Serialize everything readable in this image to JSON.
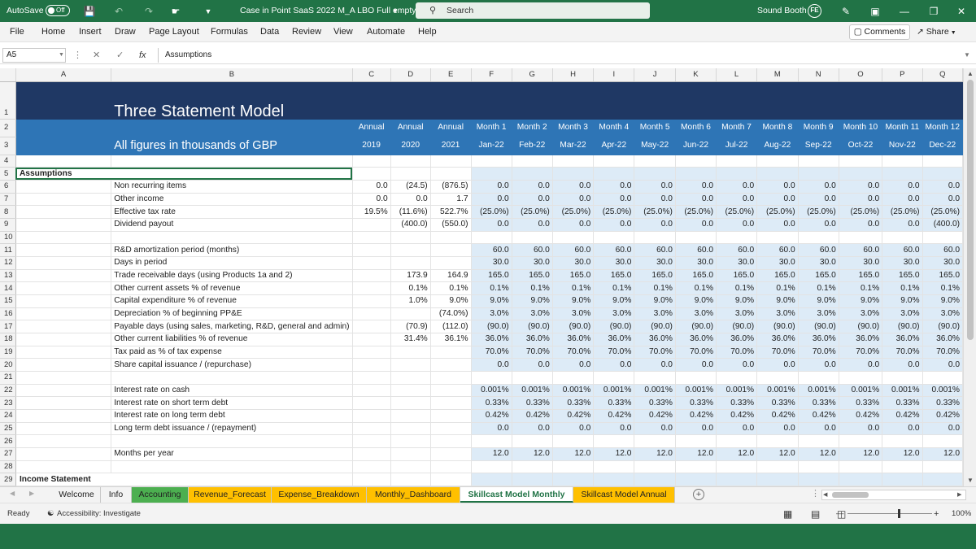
{
  "titlebar": {
    "autosave_label": "AutoSave",
    "autosave_state": "Off",
    "file_title": "Case in Point SaaS 2022 M_A LBO Full empty",
    "search_placeholder": "Search",
    "user_name": "Sound Booth",
    "user_initials": "FE"
  },
  "menu": [
    "File",
    "Home",
    "Insert",
    "Draw",
    "Page Layout",
    "Formulas",
    "Data",
    "Review",
    "View",
    "Automate",
    "Help"
  ],
  "comments_label": "Comments",
  "share_label": "Share",
  "formula_bar": {
    "name_box": "A5",
    "fx": "fx",
    "formula": "Assumptions"
  },
  "columns": [
    "A",
    "B",
    "C",
    "D",
    "E",
    "F",
    "G",
    "H",
    "I",
    "J",
    "K",
    "L",
    "M",
    "N",
    "O",
    "P",
    "Q"
  ],
  "sheet": {
    "title": "Three Statement Model",
    "subtitle": "All figures in thousands of GBP",
    "period_types": [
      "Annual",
      "Annual",
      "Annual",
      "Month 1",
      "Month 2",
      "Month 3",
      "Month 4",
      "Month 5",
      "Month 6",
      "Month 7",
      "Month 8",
      "Month 9",
      "Month 10",
      "Month 11",
      "Month 12"
    ],
    "periods": [
      "2019",
      "2020",
      "2021",
      "Jan-22",
      "Feb-22",
      "Mar-22",
      "Apr-22",
      "May-22",
      "Jun-22",
      "Jul-22",
      "Aug-22",
      "Sep-22",
      "Oct-22",
      "Nov-22",
      "Dec-22"
    ],
    "rows": [
      {
        "n": "4",
        "label": "",
        "vals": [
          "",
          "",
          "",
          "",
          "",
          "",
          "",
          "",
          "",
          "",
          "",
          "",
          "",
          "",
          ""
        ]
      },
      {
        "n": "5",
        "label": "Assumptions",
        "bold": true,
        "indent": false,
        "vals": [
          "",
          "",
          "",
          "",
          "",
          "",
          "",
          "",
          "",
          "",
          "",
          "",
          "",
          "",
          ""
        ]
      },
      {
        "n": "6",
        "label": "Non recurring items",
        "vals": [
          "0.0",
          "(24.5)",
          "(876.5)",
          "0.0",
          "0.0",
          "0.0",
          "0.0",
          "0.0",
          "0.0",
          "0.0",
          "0.0",
          "0.0",
          "0.0",
          "0.0",
          "0.0"
        ]
      },
      {
        "n": "7",
        "label": "Other income",
        "vals": [
          "0.0",
          "0.0",
          "1.7",
          "0.0",
          "0.0",
          "0.0",
          "0.0",
          "0.0",
          "0.0",
          "0.0",
          "0.0",
          "0.0",
          "0.0",
          "0.0",
          "0.0"
        ]
      },
      {
        "n": "8",
        "label": "Effective tax rate",
        "vals": [
          "19.5%",
          "(11.6%)",
          "522.7%",
          "(25.0%)",
          "(25.0%)",
          "(25.0%)",
          "(25.0%)",
          "(25.0%)",
          "(25.0%)",
          "(25.0%)",
          "(25.0%)",
          "(25.0%)",
          "(25.0%)",
          "(25.0%)",
          "(25.0%)"
        ]
      },
      {
        "n": "9",
        "label": "Dividend payout",
        "vals": [
          "",
          "(400.0)",
          "(550.0)",
          "0.0",
          "0.0",
          "0.0",
          "0.0",
          "0.0",
          "0.0",
          "0.0",
          "0.0",
          "0.0",
          "0.0",
          "0.0",
          "(400.0)"
        ]
      },
      {
        "n": "10",
        "label": "",
        "vals": [
          "",
          "",
          "",
          "",
          "",
          "",
          "",
          "",
          "",
          "",
          "",
          "",
          "",
          "",
          ""
        ]
      },
      {
        "n": "11",
        "label": "R&D amortization period (months)",
        "vals": [
          "",
          "",
          "",
          "60.0",
          "60.0",
          "60.0",
          "60.0",
          "60.0",
          "60.0",
          "60.0",
          "60.0",
          "60.0",
          "60.0",
          "60.0",
          "60.0"
        ]
      },
      {
        "n": "12",
        "label": "Days in period",
        "vals": [
          "",
          "",
          "",
          "30.0",
          "30.0",
          "30.0",
          "30.0",
          "30.0",
          "30.0",
          "30.0",
          "30.0",
          "30.0",
          "30.0",
          "30.0",
          "30.0"
        ]
      },
      {
        "n": "13",
        "label": "Trade receivable days (using Products 1a and 2)",
        "vals": [
          "",
          "173.9",
          "164.9",
          "165.0",
          "165.0",
          "165.0",
          "165.0",
          "165.0",
          "165.0",
          "165.0",
          "165.0",
          "165.0",
          "165.0",
          "165.0",
          "165.0"
        ]
      },
      {
        "n": "14",
        "label": "Other current assets % of revenue",
        "vals": [
          "",
          "0.1%",
          "0.1%",
          "0.1%",
          "0.1%",
          "0.1%",
          "0.1%",
          "0.1%",
          "0.1%",
          "0.1%",
          "0.1%",
          "0.1%",
          "0.1%",
          "0.1%",
          "0.1%"
        ]
      },
      {
        "n": "15",
        "label": "Capital expenditure % of revenue",
        "vals": [
          "",
          "1.0%",
          "9.0%",
          "9.0%",
          "9.0%",
          "9.0%",
          "9.0%",
          "9.0%",
          "9.0%",
          "9.0%",
          "9.0%",
          "9.0%",
          "9.0%",
          "9.0%",
          "9.0%"
        ]
      },
      {
        "n": "16",
        "label": "Depreciation % of beginning PP&E",
        "vals": [
          "",
          "",
          "(74.0%)",
          "3.0%",
          "3.0%",
          "3.0%",
          "3.0%",
          "3.0%",
          "3.0%",
          "3.0%",
          "3.0%",
          "3.0%",
          "3.0%",
          "3.0%",
          "3.0%"
        ]
      },
      {
        "n": "17",
        "label": "Payable days (using sales, marketing, R&D, general and admin)",
        "vals": [
          "",
          "(70.9)",
          "(112.0)",
          "(90.0)",
          "(90.0)",
          "(90.0)",
          "(90.0)",
          "(90.0)",
          "(90.0)",
          "(90.0)",
          "(90.0)",
          "(90.0)",
          "(90.0)",
          "(90.0)",
          "(90.0)"
        ]
      },
      {
        "n": "18",
        "label": "Other current liabilities % of revenue",
        "vals": [
          "",
          "31.4%",
          "36.1%",
          "36.0%",
          "36.0%",
          "36.0%",
          "36.0%",
          "36.0%",
          "36.0%",
          "36.0%",
          "36.0%",
          "36.0%",
          "36.0%",
          "36.0%",
          "36.0%"
        ]
      },
      {
        "n": "19",
        "label": "Tax paid as  % of tax expense",
        "vals": [
          "",
          "",
          "",
          "70.0%",
          "70.0%",
          "70.0%",
          "70.0%",
          "70.0%",
          "70.0%",
          "70.0%",
          "70.0%",
          "70.0%",
          "70.0%",
          "70.0%",
          "70.0%"
        ]
      },
      {
        "n": "20",
        "label": "Share capital issuance / (repurchase)",
        "vals": [
          "",
          "",
          "",
          "0.0",
          "0.0",
          "0.0",
          "0.0",
          "0.0",
          "0.0",
          "0.0",
          "0.0",
          "0.0",
          "0.0",
          "0.0",
          "0.0"
        ]
      },
      {
        "n": "21",
        "label": "",
        "vals": [
          "",
          "",
          "",
          "",
          "",
          "",
          "",
          "",
          "",
          "",
          "",
          "",
          "",
          "",
          ""
        ]
      },
      {
        "n": "22",
        "label": "Interest rate on cash",
        "vals": [
          "",
          "",
          "",
          "0.001%",
          "0.001%",
          "0.001%",
          "0.001%",
          "0.001%",
          "0.001%",
          "0.001%",
          "0.001%",
          "0.001%",
          "0.001%",
          "0.001%",
          "0.001%"
        ]
      },
      {
        "n": "23",
        "label": "Interest rate on short term debt",
        "vals": [
          "",
          "",
          "",
          "0.33%",
          "0.33%",
          "0.33%",
          "0.33%",
          "0.33%",
          "0.33%",
          "0.33%",
          "0.33%",
          "0.33%",
          "0.33%",
          "0.33%",
          "0.33%"
        ]
      },
      {
        "n": "24",
        "label": "Interest rate on long term debt",
        "vals": [
          "",
          "",
          "",
          "0.42%",
          "0.42%",
          "0.42%",
          "0.42%",
          "0.42%",
          "0.42%",
          "0.42%",
          "0.42%",
          "0.42%",
          "0.42%",
          "0.42%",
          "0.42%"
        ]
      },
      {
        "n": "25",
        "label": "Long term debt issuance / (repayment)",
        "vals": [
          "",
          "",
          "",
          "0.0",
          "0.0",
          "0.0",
          "0.0",
          "0.0",
          "0.0",
          "0.0",
          "0.0",
          "0.0",
          "0.0",
          "0.0",
          "0.0"
        ]
      },
      {
        "n": "26",
        "label": "",
        "vals": [
          "",
          "",
          "",
          "",
          "",
          "",
          "",
          "",
          "",
          "",
          "",
          "",
          "",
          "",
          ""
        ]
      },
      {
        "n": "27",
        "label": "Months per year",
        "vals": [
          "",
          "",
          "",
          "12.0",
          "12.0",
          "12.0",
          "12.0",
          "12.0",
          "12.0",
          "12.0",
          "12.0",
          "12.0",
          "12.0",
          "12.0",
          "12.0"
        ]
      },
      {
        "n": "28",
        "label": "",
        "vals": [
          "",
          "",
          "",
          "",
          "",
          "",
          "",
          "",
          "",
          "",
          "",
          "",
          "",
          "",
          ""
        ]
      },
      {
        "n": "29",
        "label": "Income Statement",
        "bold": true,
        "indent": false,
        "vals": [
          "",
          "",
          "",
          "",
          "",
          "",
          "",
          "",
          "",
          "",
          "",
          "",
          "",
          "",
          ""
        ]
      }
    ]
  },
  "tabs": [
    "Welcome",
    "Info",
    "Accounting",
    "Revenue_Forecast",
    "Expense_Breakdown",
    "Monthly_Dashboard",
    "Skillcast Model Monthly",
    "Skillcast Model Annual"
  ],
  "tab_colors": [
    "",
    "",
    "#4caf50",
    "#ffc000",
    "#ffc000",
    "#ffc000",
    "",
    "#ffc000"
  ],
  "active_tab": "Skillcast Model Monthly",
  "status": {
    "ready": "Ready",
    "accessibility": "Accessibility: Investigate",
    "zoom": "100%"
  }
}
